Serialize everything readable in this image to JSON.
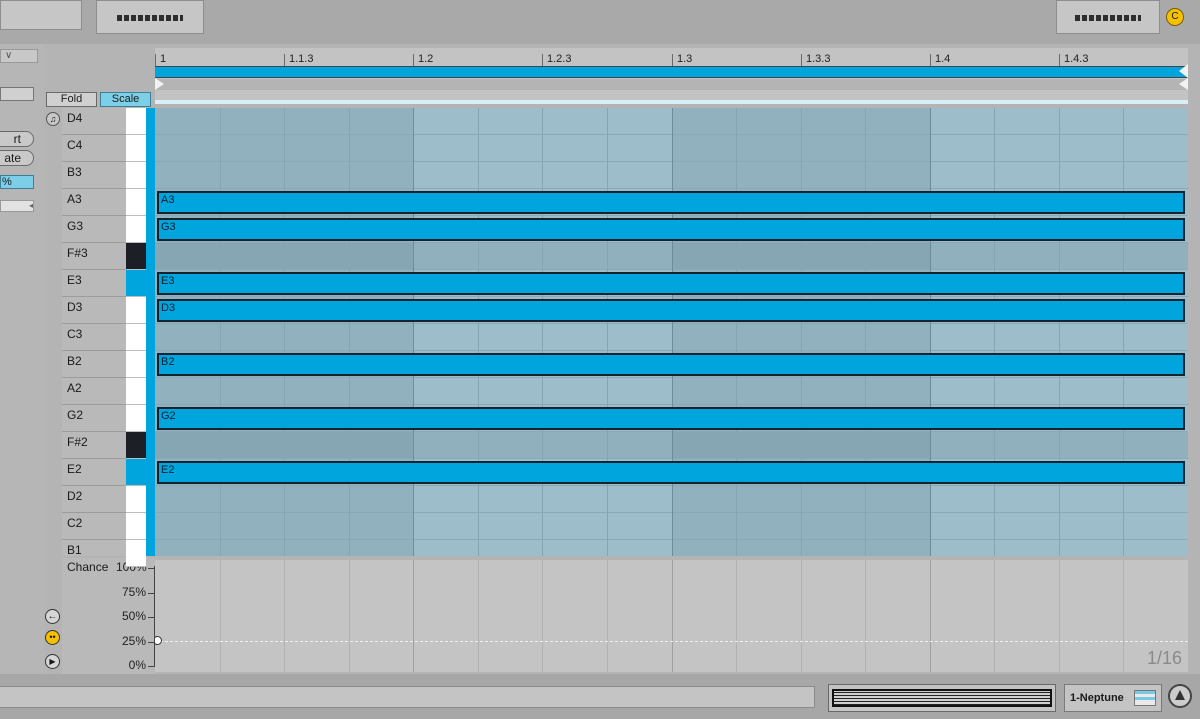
{
  "toolbar": {
    "fold_label": "Fold",
    "scale_label": "Scale"
  },
  "left_panel": {
    "items": [
      "rt",
      "ate",
      "%"
    ]
  },
  "ruler": {
    "ticks": [
      "1",
      "1.1.3",
      "1.2",
      "1.2.3",
      "1.3",
      "1.3.3",
      "1.4",
      "1.4.3"
    ]
  },
  "keys": [
    "D4",
    "C4",
    "B3",
    "A3",
    "G3",
    "F#3",
    "E3",
    "D3",
    "C3",
    "B2",
    "A2",
    "G2",
    "F#2",
    "E2",
    "D2",
    "C2",
    "B1"
  ],
  "black_keys": [
    "F#3",
    "F#2"
  ],
  "highlight_keys": [
    "E3",
    "E2"
  ],
  "notes": [
    "A3",
    "G3",
    "E3",
    "D3",
    "B2",
    "G2",
    "E2"
  ],
  "chance": {
    "label": "Chance",
    "levels": [
      "100%",
      "75%",
      "50%",
      "25%",
      "0%"
    ],
    "value_percent": 25
  },
  "grid_quantize": "1/16",
  "track_name": "1-Neptune",
  "colors": {
    "accent": "#00a5de",
    "note_border": "#152330",
    "top_badge": "#f5c000"
  },
  "top_badge_letter": "C"
}
